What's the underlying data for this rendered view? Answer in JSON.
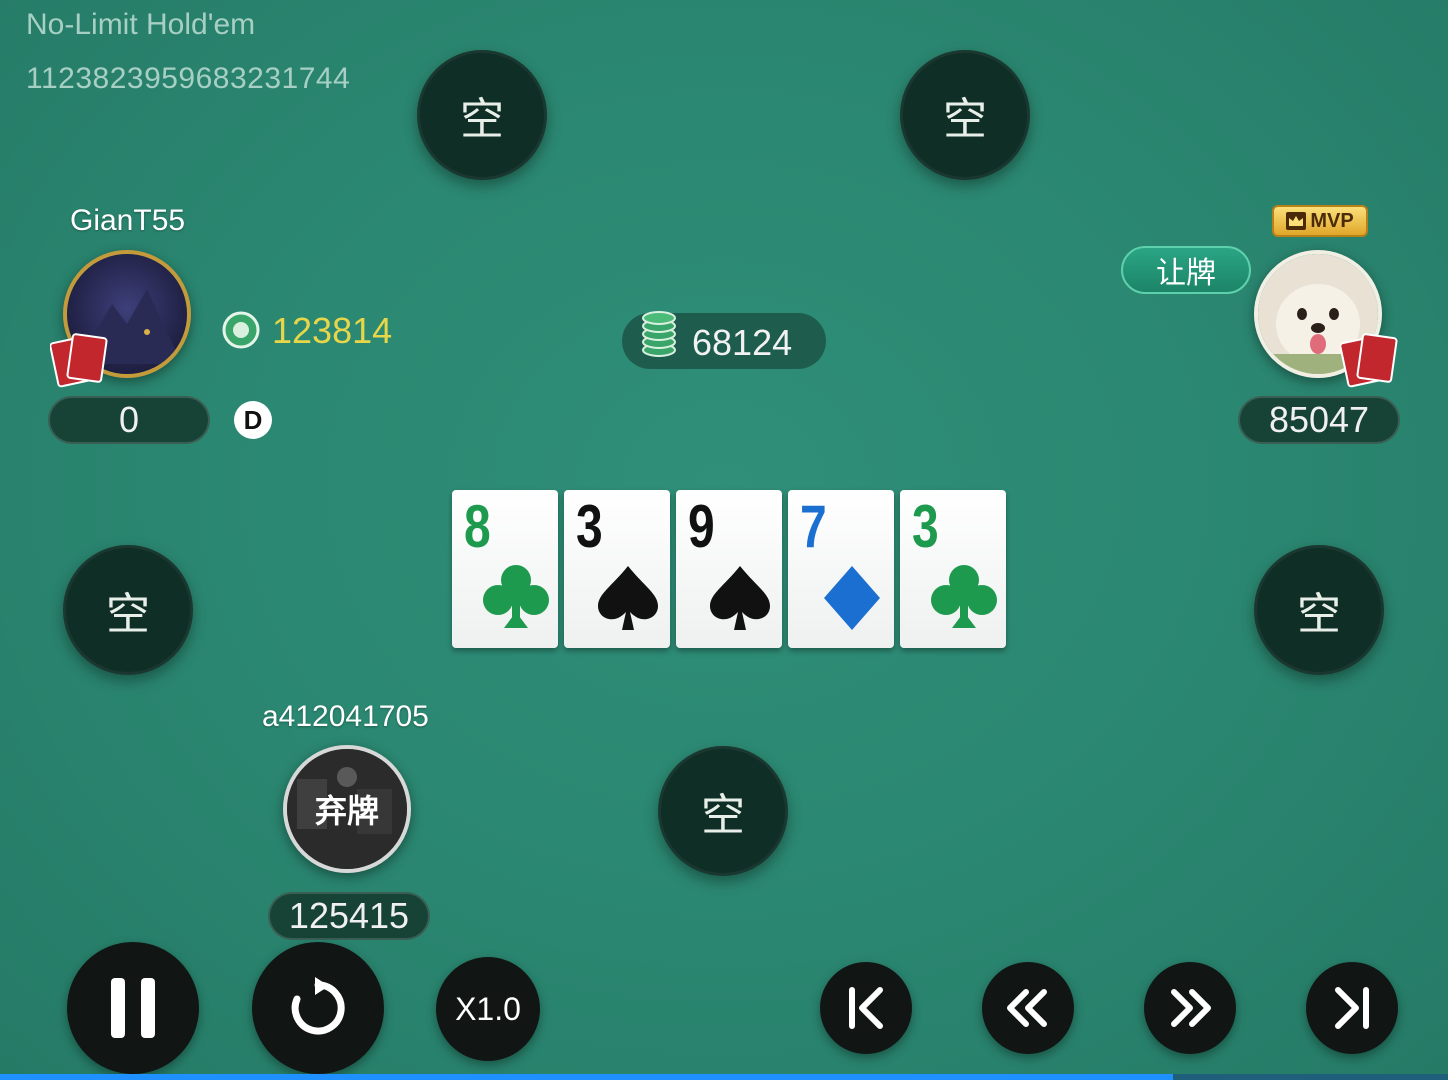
{
  "game": {
    "title": "No-Limit Hold'em",
    "id": "1123823959683231744"
  },
  "empty_seat_label": "空",
  "players": {
    "left": {
      "name": "GianT55",
      "chips": "123814",
      "bet": "0",
      "dealer": "D"
    },
    "right": {
      "action": "让牌",
      "badge": "MVP",
      "stack": "85047"
    },
    "bottom": {
      "name": "a412041705",
      "status": "弃牌",
      "stack": "125415"
    }
  },
  "pot": {
    "value": "68124"
  },
  "board": [
    {
      "rank": "8",
      "suit": "club",
      "color": "#1e9a4e"
    },
    {
      "rank": "3",
      "suit": "spade",
      "color": "#111111"
    },
    {
      "rank": "9",
      "suit": "spade",
      "color": "#111111"
    },
    {
      "rank": "7",
      "suit": "diamond",
      "color": "#1b6fd0"
    },
    {
      "rank": "3",
      "suit": "club",
      "color": "#1e9a4e"
    }
  ],
  "controls": {
    "speed": "X1.0",
    "progress": 0.81
  },
  "colors": {
    "table": "#2a8670",
    "seat": "#0f2e25",
    "chip_amount": "#e7d64a"
  }
}
